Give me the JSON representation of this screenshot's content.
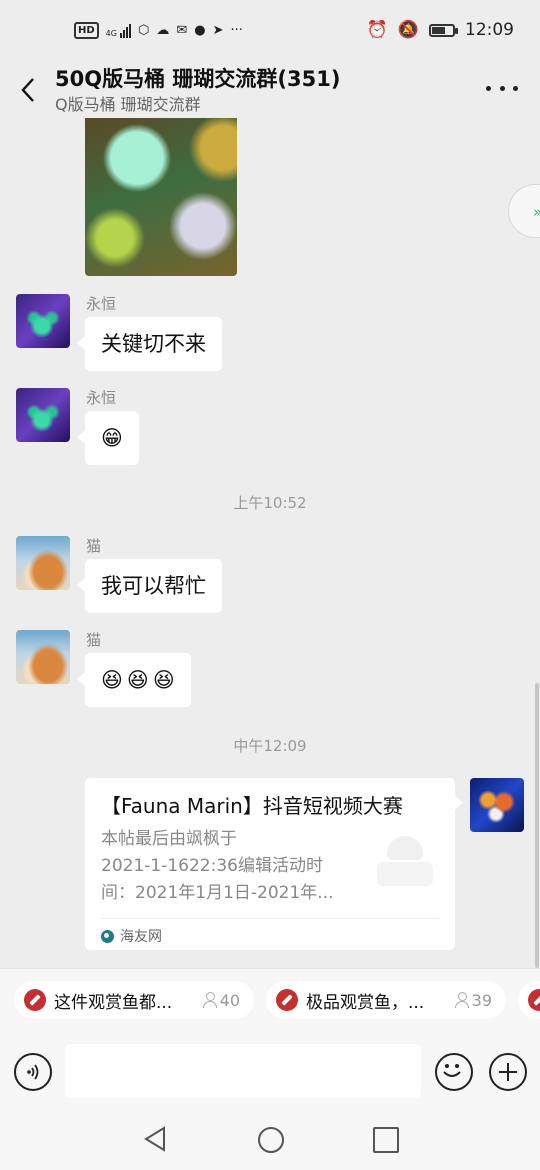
{
  "status_bar": {
    "hd_label": "HD",
    "network": "4G",
    "time": "12:09",
    "icons": [
      "signal-icon",
      "app-icon",
      "cloud-icon",
      "mail-icon",
      "qq-icon",
      "location-icon",
      "more-notifications-icon",
      "alarm-icon",
      "mute-icon",
      "battery-icon"
    ],
    "battery_level": 0.6
  },
  "header": {
    "title": "50Q版马桶 珊瑚交流群(351)",
    "subtitle": "Q版马桶 珊瑚交流群"
  },
  "messages": [
    {
      "sender": "永恒",
      "text": "关键切不来"
    },
    {
      "sender": "永恒",
      "emoji": [
        "😁"
      ]
    },
    {
      "time": "上午10:52"
    },
    {
      "sender": "猫",
      "text": "我可以帮忙"
    },
    {
      "sender": "猫",
      "emoji": [
        "😆",
        "😆",
        "😆"
      ]
    },
    {
      "time": "中午12:09"
    }
  ],
  "link_card": {
    "title": "【Fauna Marin】抖音短视频大赛",
    "desc_lines": [
      "本帖最后由飒枫于",
      "2021-1-1622:36编辑活动时",
      "间：2021年1月1日-2021年..."
    ],
    "source": "海友网"
  },
  "quick_bar": [
    {
      "text": "这件观赏鱼都...",
      "count": "40"
    },
    {
      "text": "极品观赏鱼，...",
      "count": "39"
    }
  ],
  "input": {
    "placeholder": ""
  }
}
